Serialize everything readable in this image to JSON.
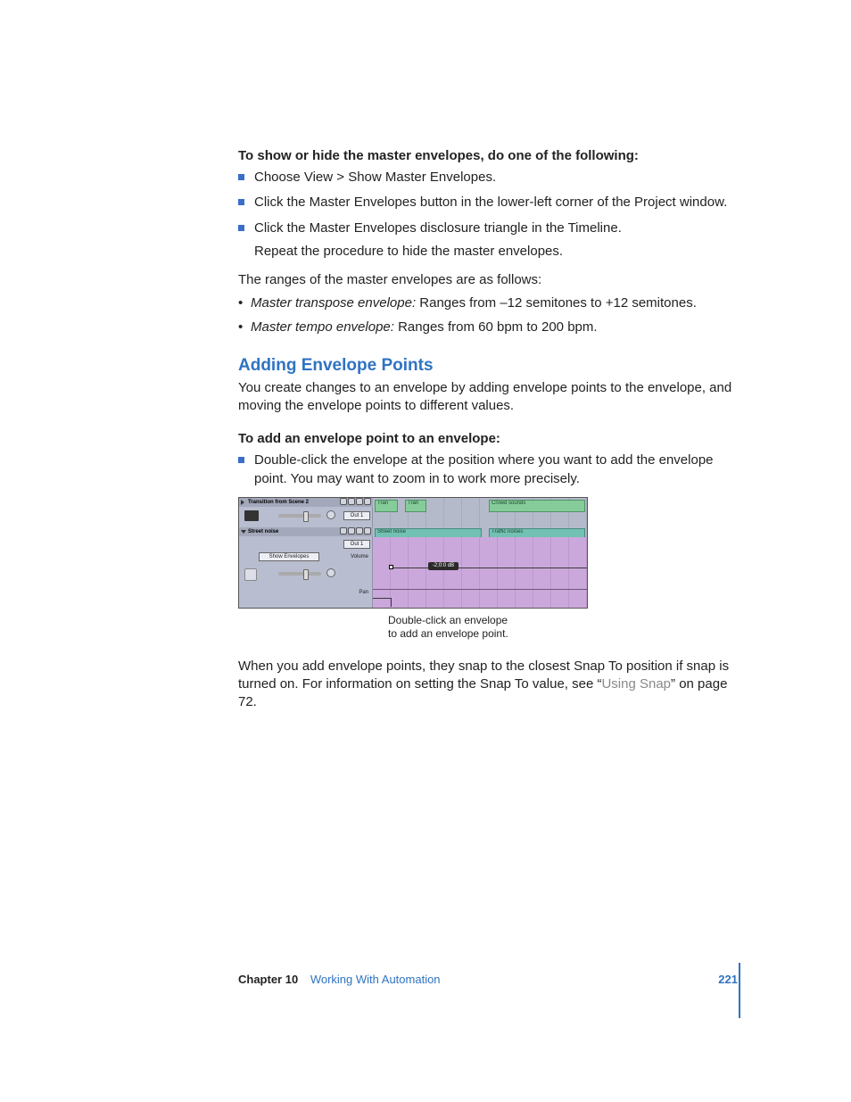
{
  "intro_heading": "To show or hide the master envelopes, do one of the following:",
  "square_list": [
    "Choose View > Show Master Envelopes.",
    "Click the Master Envelopes button in the lower-left corner of the Project window.",
    "Click the Master Envelopes disclosure triangle in the Timeline."
  ],
  "repeat_note": "Repeat the procedure to hide the master envelopes.",
  "ranges_intro": "The ranges of the master envelopes are as follows:",
  "range_items": [
    {
      "term": "Master transpose envelope:",
      "desc": "  Ranges from –12 semitones to +12 semitones."
    },
    {
      "term": "Master tempo envelope:",
      "desc": "  Ranges from 60 bpm to 200 bpm."
    }
  ],
  "section_heading": "Adding Envelope Points",
  "section_intro": "You create changes to an envelope by adding envelope points to the envelope, and moving the envelope points to different values.",
  "sub_heading": "To add an envelope point to an envelope:",
  "sub_item": "Double-click the envelope at the position where you want to add the envelope point. You may want to zoom in to work more precisely.",
  "screenshot": {
    "track1_title": "Transition from Scene 2",
    "track2_title": "Street noise",
    "out_label": "Out 1",
    "showenv_label": "Show Envelopes",
    "badge": "-2;0:0 dB",
    "vol_label": "Volume",
    "pan_label": "Pan",
    "clip_tran": "Tran",
    "clip_crowd": "Crowd sounds",
    "clip_street": "Street noise",
    "clip_traffic": "Traffic noises"
  },
  "caption_line1": "Double-click an envelope",
  "caption_line2": "to add an envelope point.",
  "closing_pre": "When you add envelope points, they snap to the closest Snap To position if snap is turned on. For information on setting the Snap To value, see “",
  "closing_link": "Using Snap",
  "closing_post": "” on page 72.",
  "footer": {
    "chapter_label": "Chapter 10",
    "chapter_title": "Working With Automation",
    "page_num": "221"
  }
}
